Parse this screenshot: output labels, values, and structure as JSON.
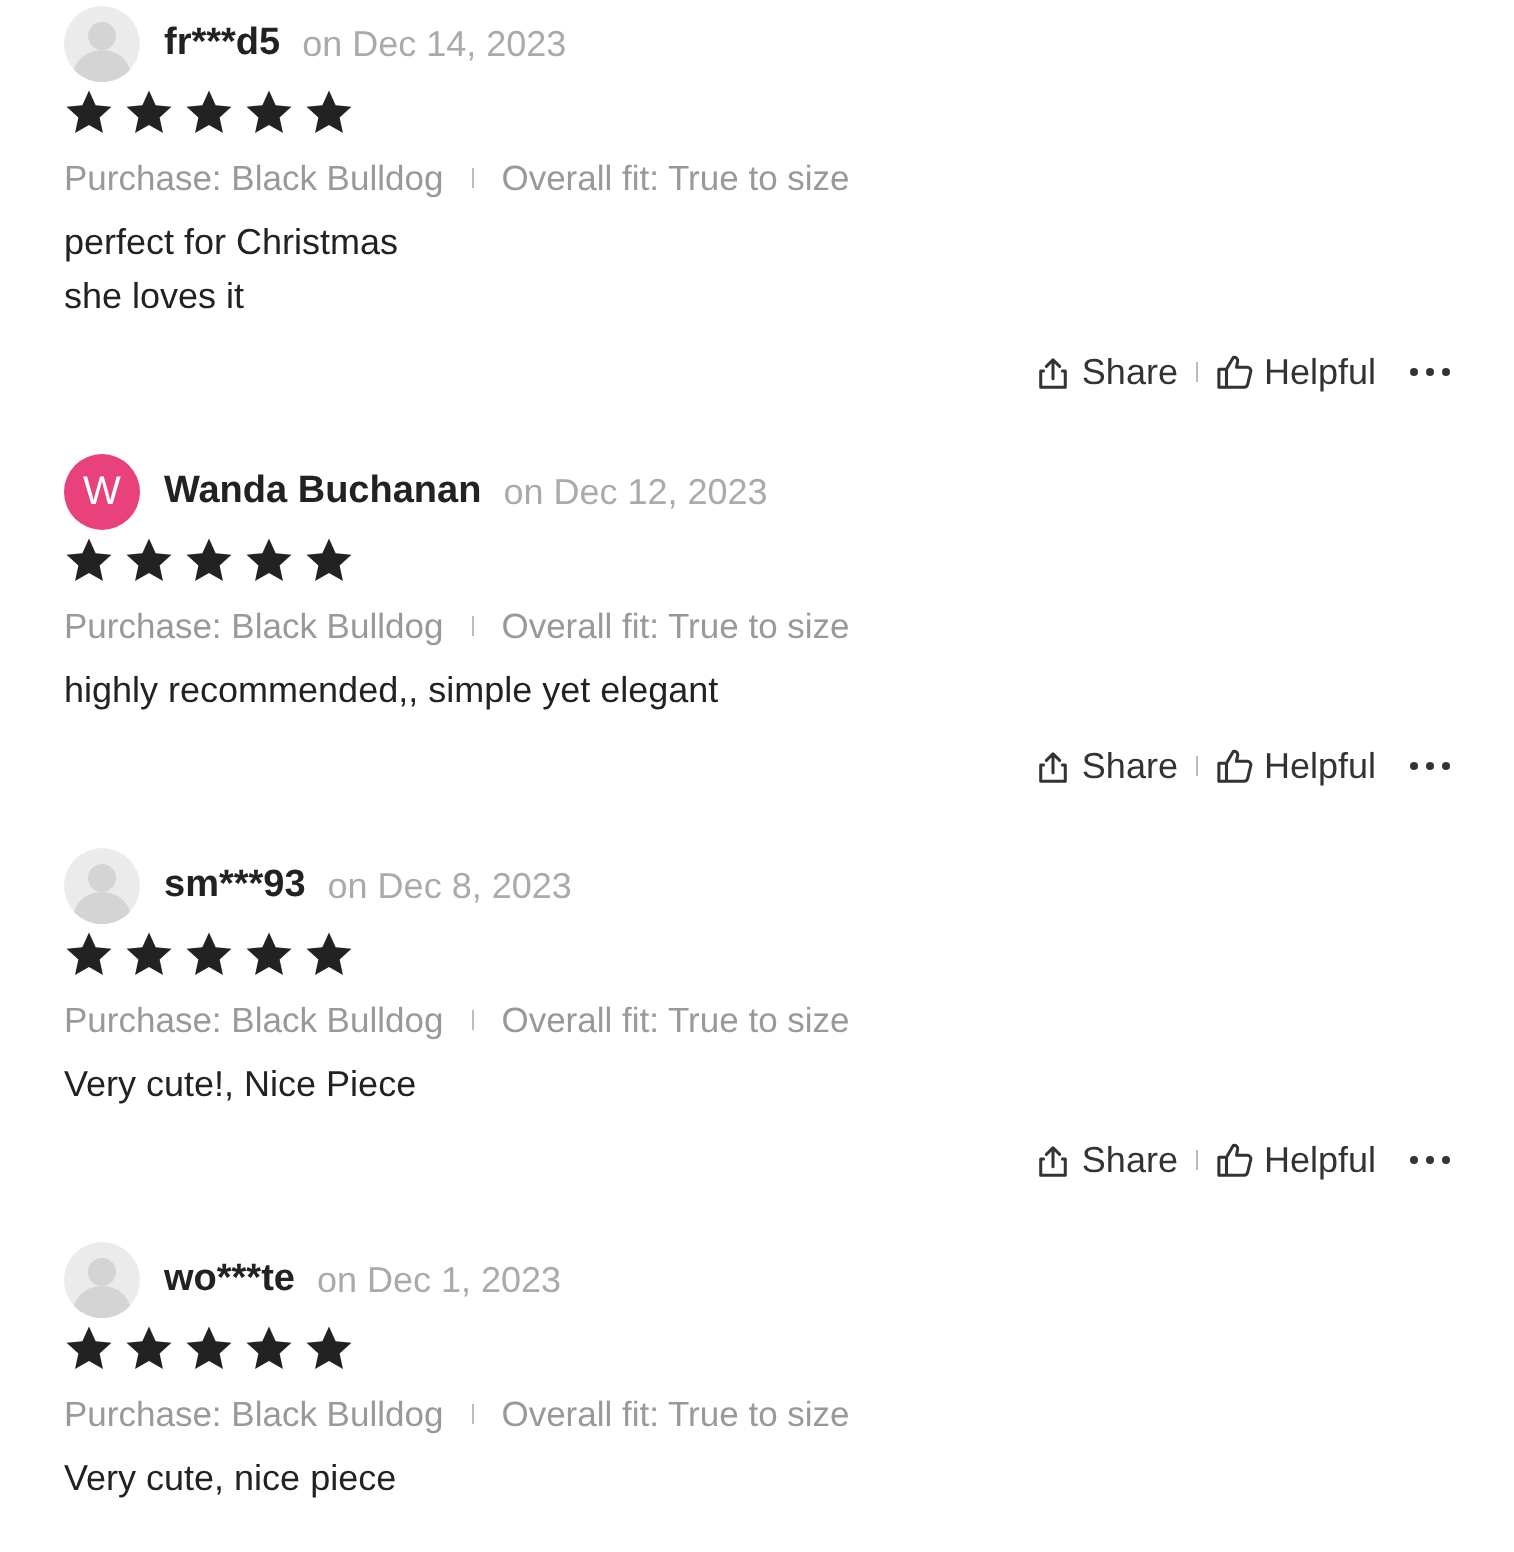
{
  "reviews": [
    {
      "reviewer": "fr***d5",
      "avatar": {
        "kind": "placeholder"
      },
      "date": "on Dec 14, 2023",
      "stars": 5,
      "purchase": "Purchase: Black Bulldog",
      "fit": "Overall fit: True to size",
      "text": "perfect for Christmas\nshe loves it",
      "actions": {
        "share": "Share",
        "helpful": "Helpful"
      }
    },
    {
      "reviewer": "Wanda Buchanan",
      "avatar": {
        "kind": "initial",
        "letter": "W",
        "color": "#e8417c"
      },
      "date": "on Dec 12, 2023",
      "stars": 5,
      "purchase": "Purchase: Black Bulldog",
      "fit": "Overall fit: True to size",
      "text": "highly recommended,, simple yet elegant",
      "actions": {
        "share": "Share",
        "helpful": "Helpful"
      }
    },
    {
      "reviewer": "sm***93",
      "avatar": {
        "kind": "placeholder"
      },
      "date": "on Dec 8, 2023",
      "stars": 5,
      "purchase": "Purchase: Black Bulldog",
      "fit": "Overall fit: True to size",
      "text": "Very cute!, Nice Piece",
      "actions": {
        "share": "Share",
        "helpful": "Helpful"
      }
    },
    {
      "reviewer": "wo***te",
      "avatar": {
        "kind": "placeholder"
      },
      "date": "on Dec 1, 2023",
      "stars": 5,
      "purchase": "Purchase: Black Bulldog",
      "fit": "Overall fit: True to size",
      "text": "Very cute, nice piece"
    }
  ]
}
